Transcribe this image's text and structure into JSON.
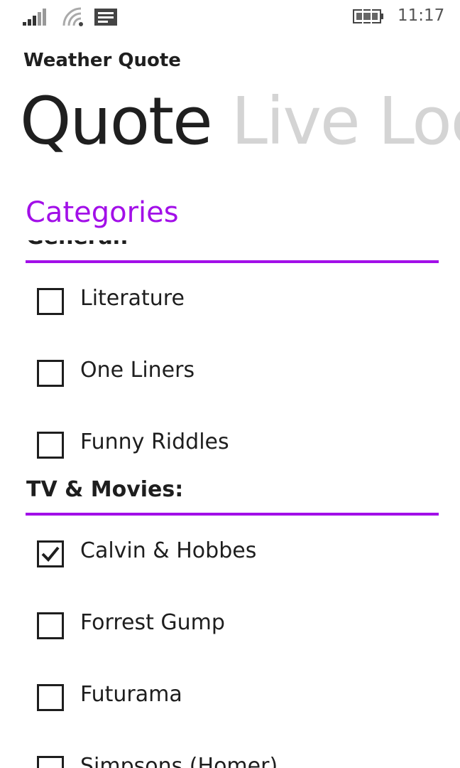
{
  "status_bar": {
    "time": "11:17",
    "icons": [
      "signal-icon",
      "wifi-icon",
      "message-icon",
      "battery-icon"
    ]
  },
  "app": {
    "title": "Weather Quote"
  },
  "pivot": {
    "tabs": [
      {
        "label": "Quote",
        "active": true
      },
      {
        "label": "Live Loc",
        "active": false
      }
    ]
  },
  "section": {
    "title": "Categories"
  },
  "groups": [
    {
      "header": "General:",
      "items": [
        {
          "label": "Literature",
          "checked": false
        },
        {
          "label": "One Liners",
          "checked": false
        },
        {
          "label": "Funny Riddles",
          "checked": false
        }
      ]
    },
    {
      "header": "TV & Movies:",
      "items": [
        {
          "label": "Calvin & Hobbes",
          "checked": true
        },
        {
          "label": "Forrest Gump",
          "checked": false
        },
        {
          "label": "Futurama",
          "checked": false
        },
        {
          "label": "Simpsons (Homer)",
          "checked": false
        }
      ]
    }
  ],
  "colors": {
    "accent": "#a20fe8",
    "text": "#1e1e1e",
    "inactive_tab": "#d4d4d4"
  }
}
